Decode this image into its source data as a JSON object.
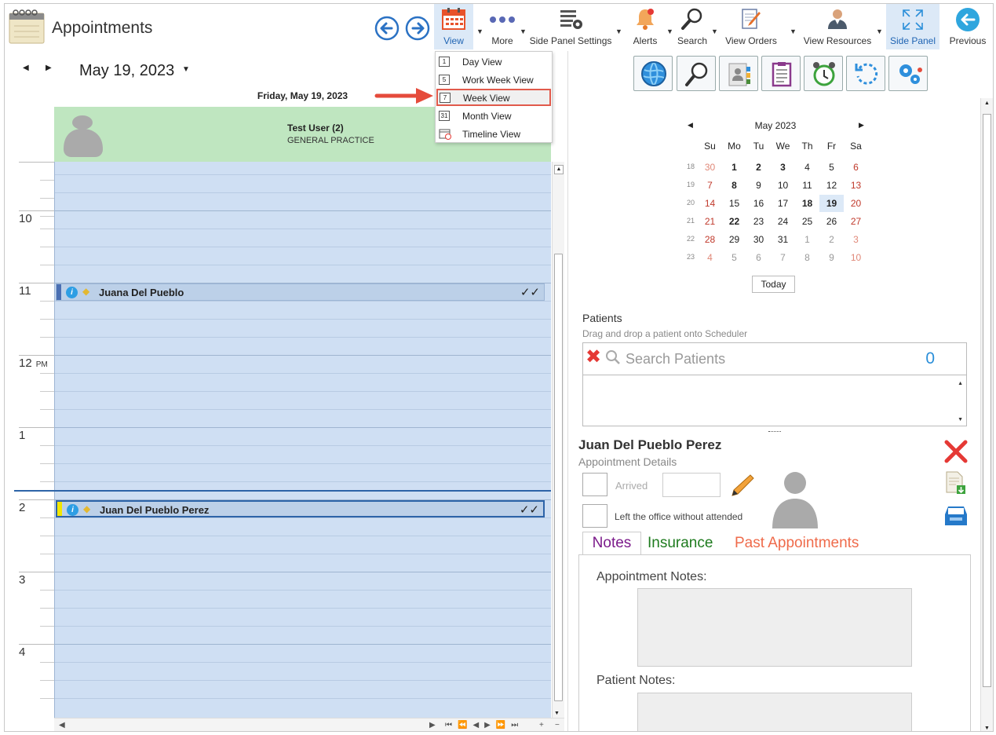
{
  "app": {
    "title": "Appointments"
  },
  "toolbar": {
    "view": "View",
    "more": "More",
    "side_panel_settings": "Side Panel Settings",
    "alerts": "Alerts",
    "search": "Search",
    "view_orders": "View Orders",
    "view_resources": "View Resources",
    "side_panel": "Side Panel",
    "previous": "Previous"
  },
  "view_menu": {
    "items": [
      {
        "num": "1",
        "label": "Day View"
      },
      {
        "num": "5",
        "label": "Work Week View"
      },
      {
        "num": "7",
        "label": "Week View"
      },
      {
        "num": "31",
        "label": "Month View"
      },
      {
        "num": "",
        "label": "Timeline View"
      }
    ],
    "highlighted": "Week View"
  },
  "scheduler": {
    "date": "May 19, 2023",
    "day_header": "Friday, May 19, 2023",
    "resource_name": "Test User (2)",
    "resource_specialty": "GENERAL PRACTICE",
    "hours": [
      "10",
      "11",
      "12",
      "1",
      "2",
      "3",
      "4"
    ],
    "pm_label": "PM",
    "appointments": [
      {
        "name": "Juana Del Pueblo",
        "status": "✓✓",
        "bar_color": "#4a6fb3"
      },
      {
        "name": "Juan Del Pueblo Perez",
        "status": "✓✓",
        "bar_color": "#f2e600"
      }
    ]
  },
  "mini_calendar": {
    "month": "May 2023",
    "dow": [
      "Su",
      "Mo",
      "Tu",
      "We",
      "Th",
      "Fr",
      "Sa"
    ],
    "weeks": [
      {
        "wk": "18",
        "days": [
          "30",
          "1",
          "2",
          "3",
          "4",
          "5",
          "6"
        ]
      },
      {
        "wk": "19",
        "days": [
          "7",
          "8",
          "9",
          "10",
          "11",
          "12",
          "13"
        ]
      },
      {
        "wk": "20",
        "days": [
          "14",
          "15",
          "16",
          "17",
          "18",
          "19",
          "20"
        ]
      },
      {
        "wk": "21",
        "days": [
          "21",
          "22",
          "23",
          "24",
          "25",
          "26",
          "27"
        ]
      },
      {
        "wk": "22",
        "days": [
          "28",
          "29",
          "30",
          "31",
          "1",
          "2",
          "3"
        ]
      },
      {
        "wk": "23",
        "days": [
          "4",
          "5",
          "6",
          "7",
          "8",
          "9",
          "10"
        ]
      }
    ],
    "selected_day": "19",
    "today_button": "Today"
  },
  "patients": {
    "title": "Patients",
    "hint": "Drag and drop a patient onto Scheduler",
    "search_placeholder": "Search Patients",
    "count": "0"
  },
  "details": {
    "patient_name": "Juan Del Pueblo Perez",
    "subtitle": "Appointment Details",
    "arrived_label": "Arrived",
    "left_label": "Left the office without attended",
    "tabs": [
      "Notes",
      "Insurance",
      "Past Appointments"
    ],
    "appointment_notes_label": "Appointment Notes:",
    "patient_notes_label": "Patient Notes:"
  }
}
